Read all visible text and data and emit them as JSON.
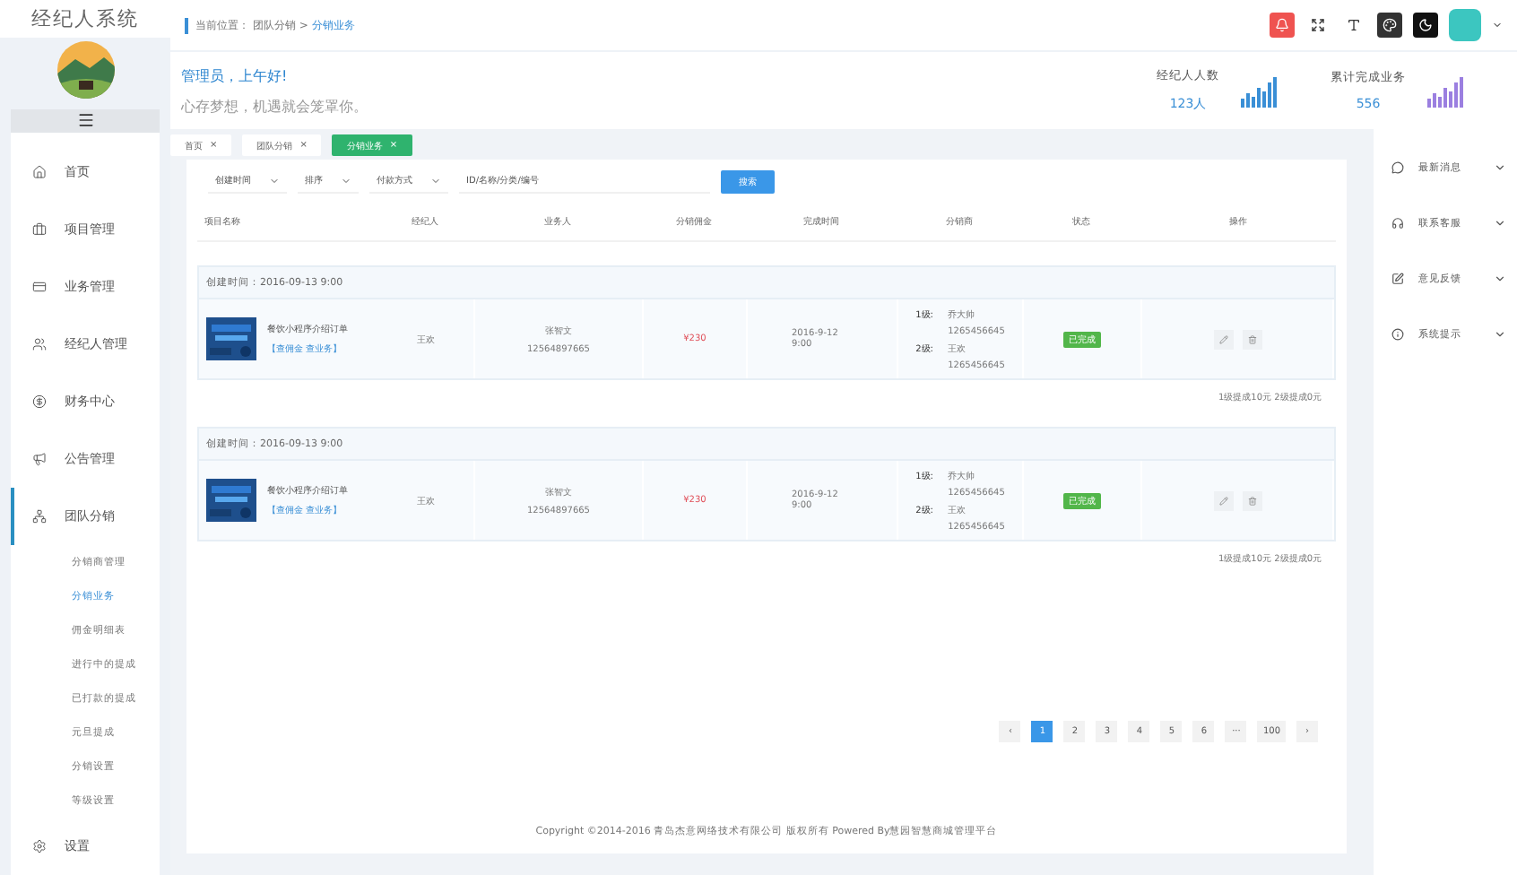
{
  "logo": "经纪人系统",
  "breadcrumb": {
    "label": "当前位置：",
    "path": "团队分销 >",
    "current": "分销业务"
  },
  "greeting": {
    "title": "管理员，上午好!",
    "subtitle": "心存梦想，机遇就会笼罩你。"
  },
  "stats": [
    {
      "label": "经纪人人数",
      "value": "123人",
      "color": "#3a8fd6"
    },
    {
      "label": "累计完成业务",
      "value": "556",
      "color": "#9b7fe0"
    }
  ],
  "sidebar": {
    "items": [
      {
        "label": "首页",
        "selected": false
      },
      {
        "label": "项目管理",
        "selected": false
      },
      {
        "label": "业务管理",
        "selected": false
      },
      {
        "label": "经纪人管理",
        "selected": false
      },
      {
        "label": "财务中心",
        "selected": false
      },
      {
        "label": "公告管理",
        "selected": false
      },
      {
        "label": "团队分销",
        "selected": true,
        "children": [
          {
            "label": "分销商管理",
            "selected": false
          },
          {
            "label": "分销业务",
            "selected": true
          },
          {
            "label": "佣金明细表",
            "selected": false
          },
          {
            "label": "进行中的提成",
            "selected": false
          },
          {
            "label": "已打款的提成",
            "selected": false
          },
          {
            "label": "元旦提成",
            "selected": false
          },
          {
            "label": "分销设置",
            "selected": false
          },
          {
            "label": "等级设置",
            "selected": false
          }
        ]
      },
      {
        "label": "设置",
        "selected": false
      }
    ]
  },
  "tabs": [
    {
      "label": "首页",
      "close": "×",
      "selected": false
    },
    {
      "label": "团队分销",
      "close": "×",
      "selected": false
    },
    {
      "label": "分销业务",
      "close": "×",
      "selected": true
    }
  ],
  "filters": {
    "selects": [
      "创建时间",
      "排序",
      "付款方式"
    ],
    "search": {
      "placeholder": "ID/名称/分类/编号"
    },
    "button": "搜索"
  },
  "table": {
    "columns": [
      "项目名称",
      "经纪人",
      "业务人",
      "分销佣金",
      "完成时间",
      "分销商",
      "状态",
      "操作"
    ],
    "groups": [
      {
        "created": "创建时间：2016-09-13 9:00",
        "project": "餐饮小程序介绍订单",
        "links": "【查佣金 查业务】",
        "agent": "王欢",
        "salesman": "张智文",
        "salesman_phone": "12564897665",
        "commission": "¥230",
        "finished": "2016-9-12 9:00",
        "distributors": [
          {
            "level": "1级:",
            "name": "乔大帅",
            "phone": "1265456645"
          },
          {
            "level": "2级:",
            "name": "王欢",
            "phone": "1265456645"
          }
        ],
        "status": "已完成",
        "summary": "1级提成10元 2级提成0元"
      },
      {
        "created": "创建时间：2016-09-13 9:00",
        "project": "餐饮小程序介绍订单",
        "links": "【查佣金 查业务】",
        "agent": "王欢",
        "salesman": "张智文",
        "salesman_phone": "12564897665",
        "commission": "¥230",
        "finished": "2016-9-12 9:00",
        "distributors": [
          {
            "level": "1级:",
            "name": "乔大帅",
            "phone": "1265456645"
          },
          {
            "level": "2级:",
            "name": "王欢",
            "phone": "1265456645"
          }
        ],
        "status": "已完成",
        "summary": "1级提成10元 2级提成0元"
      }
    ]
  },
  "pagination": {
    "prev": "‹",
    "pages": [
      {
        "label": "1",
        "selected": true
      },
      {
        "label": "2",
        "selected": false
      },
      {
        "label": "3",
        "selected": false
      },
      {
        "label": "4",
        "selected": false
      },
      {
        "label": "5",
        "selected": false
      },
      {
        "label": "6",
        "selected": false
      },
      {
        "label": "···",
        "selected": false
      },
      {
        "label": "100",
        "selected": false
      }
    ],
    "next": "›"
  },
  "footer": "Copyright ©2014-2016 青岛杰意网络技术有限公司 版权所有 Powered By慧园智慧商城管理平台",
  "right_panel": [
    {
      "label": "最新消息"
    },
    {
      "label": "联系客服"
    },
    {
      "label": "意见反馈"
    },
    {
      "label": "系统提示"
    }
  ]
}
